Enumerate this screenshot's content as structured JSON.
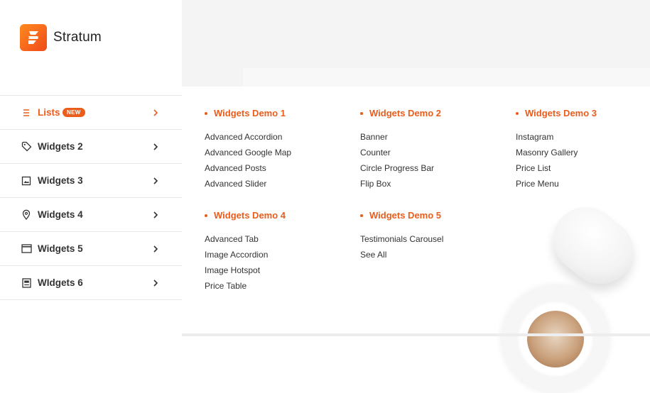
{
  "brand": {
    "name": "Stratum",
    "accent": "#ea5d1d"
  },
  "sidebar": {
    "items": [
      {
        "label": "Lists",
        "icon": "list-icon",
        "badge": "NEW",
        "active": true
      },
      {
        "label": "Widgets 2",
        "icon": "tag-icon"
      },
      {
        "label": "Widgets 3",
        "icon": "image-icon"
      },
      {
        "label": "Widgets 4",
        "icon": "map-pin-icon"
      },
      {
        "label": "Widgets 5",
        "icon": "window-icon"
      },
      {
        "label": "WIdgets 6",
        "icon": "document-icon"
      }
    ]
  },
  "menu": {
    "columns": [
      {
        "title": "Widgets Demo 1",
        "links": [
          "Advanced Accordion",
          "Advanced Google Map",
          "Advanced Posts",
          "Advanced Slider"
        ]
      },
      {
        "title": "Widgets Demo 2",
        "links": [
          "Banner",
          "Counter",
          "Circle Progress Bar",
          "Flip Box"
        ]
      },
      {
        "title": "Widgets Demo 3",
        "links": [
          "Instagram",
          "Masonry Gallery",
          "Price List",
          "Price Menu"
        ]
      },
      {
        "title": "Widgets Demo 4",
        "links": [
          "Advanced Tab",
          "Image Accordion",
          "Image Hotspot",
          "Price Table"
        ]
      },
      {
        "title": "Widgets Demo 5",
        "links": [
          "Testimonials Carousel",
          "See All"
        ]
      }
    ]
  }
}
